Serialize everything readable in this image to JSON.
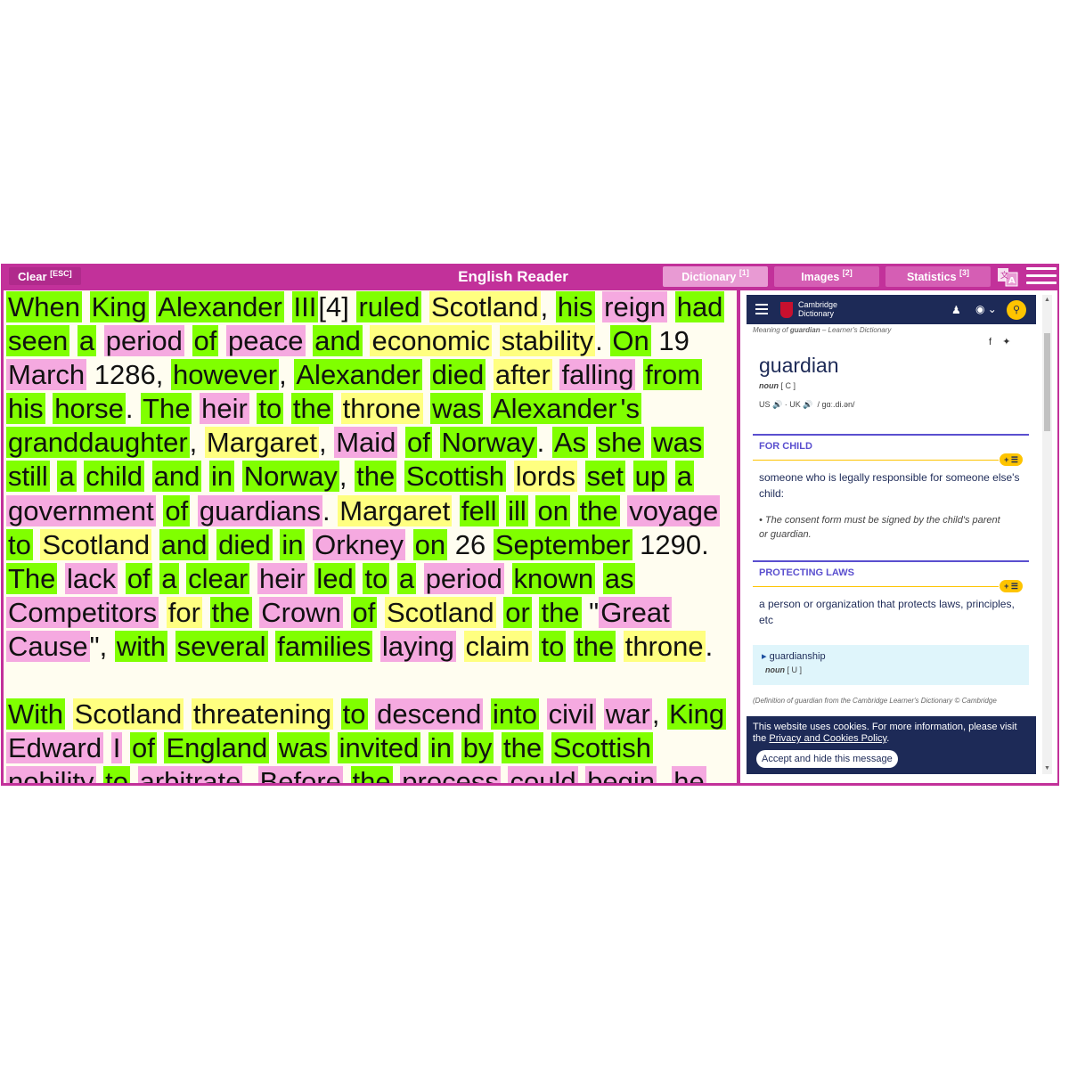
{
  "toolbar": {
    "clear_label": "Clear",
    "clear_shortcut": "[ESC]",
    "title": "English Reader",
    "tabs": [
      {
        "label": "Dictionary",
        "shortcut": "[1]"
      },
      {
        "label": "Images",
        "shortcut": "[2]"
      },
      {
        "label": "Statistics",
        "shortcut": "[3]"
      }
    ],
    "icons": [
      "translate-icon",
      "hamburger-menu-icon"
    ]
  },
  "reader": {
    "paragraphs": [
      [
        [
          "When",
          "g"
        ],
        [
          " ",
          ""
        ],
        [
          "King",
          "g"
        ],
        [
          " ",
          ""
        ],
        [
          "Alexander",
          "g"
        ],
        [
          " ",
          ""
        ],
        [
          "III",
          "g"
        ],
        [
          "[4] ",
          ""
        ],
        [
          "ruled",
          "g"
        ],
        [
          " ",
          ""
        ],
        [
          "Scotland",
          "y"
        ],
        [
          ", ",
          ""
        ],
        [
          "his",
          "g"
        ],
        [
          " ",
          ""
        ],
        [
          "reign",
          "p"
        ],
        [
          " ",
          ""
        ],
        [
          "had",
          "g"
        ],
        [
          " ",
          ""
        ],
        [
          "seen",
          "g"
        ],
        [
          " ",
          ""
        ],
        [
          "a",
          "g"
        ],
        [
          " ",
          ""
        ],
        [
          "period",
          "p"
        ],
        [
          " ",
          ""
        ],
        [
          "of",
          "g"
        ],
        [
          " ",
          ""
        ],
        [
          "peace",
          "p"
        ],
        [
          " ",
          ""
        ],
        [
          "and",
          "g"
        ],
        [
          " ",
          ""
        ],
        [
          "economic",
          "y"
        ],
        [
          " ",
          ""
        ],
        [
          "stability",
          "y"
        ],
        [
          ". ",
          ""
        ],
        [
          "On",
          "g"
        ],
        [
          " 19 ",
          ""
        ],
        [
          "March",
          "p"
        ],
        [
          " 1286, ",
          ""
        ],
        [
          "however",
          "g"
        ],
        [
          ", ",
          ""
        ],
        [
          "Alexander",
          "g"
        ],
        [
          " ",
          ""
        ],
        [
          "died",
          "g"
        ],
        [
          " ",
          ""
        ],
        [
          "after",
          "y"
        ],
        [
          " ",
          ""
        ],
        [
          "falling",
          "p"
        ],
        [
          " ",
          ""
        ],
        [
          "from",
          "g"
        ],
        [
          " ",
          ""
        ],
        [
          "his",
          "g"
        ],
        [
          " ",
          ""
        ],
        [
          "horse",
          "g"
        ],
        [
          ". ",
          ""
        ],
        [
          "The",
          "g"
        ],
        [
          " ",
          ""
        ],
        [
          "heir",
          "p"
        ],
        [
          " ",
          ""
        ],
        [
          "to",
          "g"
        ],
        [
          " ",
          ""
        ],
        [
          "the",
          "g"
        ],
        [
          " ",
          ""
        ],
        [
          "throne",
          "y"
        ],
        [
          " ",
          ""
        ],
        [
          "was",
          "g"
        ],
        [
          " ",
          ""
        ],
        [
          "Alexander",
          "g"
        ],
        [
          "'s",
          "g"
        ],
        [
          " ",
          ""
        ],
        [
          "granddaughter",
          "g"
        ],
        [
          ", ",
          ""
        ],
        [
          "Margaret",
          "y"
        ],
        [
          ", ",
          ""
        ],
        [
          "Maid",
          "p"
        ],
        [
          " ",
          ""
        ],
        [
          "of",
          "g"
        ],
        [
          " ",
          ""
        ],
        [
          "Norway",
          "g"
        ],
        [
          ". ",
          ""
        ],
        [
          "As",
          "g"
        ],
        [
          " ",
          ""
        ],
        [
          "she",
          "g"
        ],
        [
          " ",
          ""
        ],
        [
          "was",
          "g"
        ],
        [
          " ",
          ""
        ],
        [
          "still",
          "g"
        ],
        [
          " ",
          ""
        ],
        [
          "a",
          "g"
        ],
        [
          " ",
          ""
        ],
        [
          "child",
          "g"
        ],
        [
          " ",
          ""
        ],
        [
          "and",
          "g"
        ],
        [
          " ",
          ""
        ],
        [
          "in",
          "g"
        ],
        [
          " ",
          ""
        ],
        [
          "Norway",
          "g"
        ],
        [
          ", ",
          ""
        ],
        [
          "the",
          "g"
        ],
        [
          " ",
          ""
        ],
        [
          "Scottish",
          "g"
        ],
        [
          " ",
          ""
        ],
        [
          "lords",
          "y"
        ],
        [
          " ",
          ""
        ],
        [
          "set",
          "g"
        ],
        [
          " ",
          ""
        ],
        [
          "up",
          "g"
        ],
        [
          " ",
          ""
        ],
        [
          "a",
          "g"
        ],
        [
          " ",
          ""
        ],
        [
          "government",
          "p"
        ],
        [
          " ",
          ""
        ],
        [
          "of",
          "g"
        ],
        [
          " ",
          ""
        ],
        [
          "guardians",
          "p"
        ],
        [
          ". ",
          ""
        ],
        [
          "Margaret",
          "y"
        ],
        [
          " ",
          ""
        ],
        [
          "fell",
          "g"
        ],
        [
          " ",
          ""
        ],
        [
          "ill",
          "g"
        ],
        [
          " ",
          ""
        ],
        [
          "on",
          "g"
        ],
        [
          " ",
          ""
        ],
        [
          "the",
          "g"
        ],
        [
          " ",
          ""
        ],
        [
          "voyage",
          "p"
        ],
        [
          " ",
          ""
        ],
        [
          "to",
          "g"
        ],
        [
          " ",
          ""
        ],
        [
          "Scotland",
          "y"
        ],
        [
          " ",
          ""
        ],
        [
          "and",
          "g"
        ],
        [
          " ",
          ""
        ],
        [
          "died",
          "g"
        ],
        [
          " ",
          ""
        ],
        [
          "in",
          "g"
        ],
        [
          " ",
          ""
        ],
        [
          "Orkney",
          "p"
        ],
        [
          " ",
          ""
        ],
        [
          "on",
          "g"
        ],
        [
          " 26 ",
          ""
        ],
        [
          "September",
          "g"
        ],
        [
          " 1290. ",
          ""
        ],
        [
          "The",
          "g"
        ],
        [
          " ",
          ""
        ],
        [
          "lack",
          "p"
        ],
        [
          " ",
          ""
        ],
        [
          "of",
          "g"
        ],
        [
          " ",
          ""
        ],
        [
          "a",
          "g"
        ],
        [
          " ",
          ""
        ],
        [
          "clear",
          "g"
        ],
        [
          " ",
          ""
        ],
        [
          "heir",
          "p"
        ],
        [
          " ",
          ""
        ],
        [
          "led",
          "g"
        ],
        [
          " ",
          ""
        ],
        [
          "to",
          "g"
        ],
        [
          " ",
          ""
        ],
        [
          "a",
          "g"
        ],
        [
          " ",
          ""
        ],
        [
          "period",
          "p"
        ],
        [
          " ",
          ""
        ],
        [
          "known",
          "g"
        ],
        [
          " ",
          ""
        ],
        [
          "as",
          "g"
        ],
        [
          " ",
          ""
        ],
        [
          "Competitors",
          "p"
        ],
        [
          " ",
          ""
        ],
        [
          "for",
          "y"
        ],
        [
          " ",
          ""
        ],
        [
          "the",
          "g"
        ],
        [
          " ",
          ""
        ],
        [
          "Crown",
          "p"
        ],
        [
          " ",
          ""
        ],
        [
          "of",
          "g"
        ],
        [
          " ",
          ""
        ],
        [
          "Scotland",
          "y"
        ],
        [
          " ",
          ""
        ],
        [
          "or",
          "g"
        ],
        [
          " ",
          ""
        ],
        [
          "the",
          "g"
        ],
        [
          " \"",
          ""
        ],
        [
          "Great",
          "p"
        ],
        [
          " ",
          ""
        ],
        [
          "Cause",
          "p"
        ],
        [
          "\", ",
          ""
        ],
        [
          "with",
          "g"
        ],
        [
          " ",
          ""
        ],
        [
          "several",
          "g"
        ],
        [
          " ",
          ""
        ],
        [
          "families",
          "g"
        ],
        [
          " ",
          ""
        ],
        [
          "laying",
          "p"
        ],
        [
          " ",
          ""
        ],
        [
          "claim",
          "y"
        ],
        [
          " ",
          ""
        ],
        [
          "to",
          "g"
        ],
        [
          " ",
          ""
        ],
        [
          "the",
          "g"
        ],
        [
          " ",
          ""
        ],
        [
          "throne",
          "y"
        ],
        [
          ".",
          ""
        ]
      ],
      [
        [
          "With",
          "g"
        ],
        [
          " ",
          ""
        ],
        [
          "Scotland",
          "y"
        ],
        [
          " ",
          ""
        ],
        [
          "threatening",
          "y"
        ],
        [
          " ",
          ""
        ],
        [
          "to",
          "g"
        ],
        [
          " ",
          ""
        ],
        [
          "descend",
          "p"
        ],
        [
          " ",
          ""
        ],
        [
          "into",
          "g"
        ],
        [
          " ",
          ""
        ],
        [
          "civil",
          "p"
        ],
        [
          " ",
          ""
        ],
        [
          "war",
          "p"
        ],
        [
          ", ",
          ""
        ],
        [
          "King",
          "g"
        ],
        [
          " ",
          ""
        ],
        [
          "Edward",
          "p"
        ],
        [
          " ",
          ""
        ],
        [
          "I",
          "p"
        ],
        [
          " ",
          ""
        ],
        [
          "of",
          "g"
        ],
        [
          " ",
          ""
        ],
        [
          "England",
          "g"
        ],
        [
          " ",
          ""
        ],
        [
          "was",
          "g"
        ],
        [
          " ",
          ""
        ],
        [
          "invited",
          "g"
        ],
        [
          " ",
          ""
        ],
        [
          "in",
          "g"
        ],
        [
          " ",
          ""
        ],
        [
          "by",
          "g"
        ],
        [
          " ",
          ""
        ],
        [
          "the",
          "g"
        ],
        [
          " ",
          ""
        ],
        [
          "Scottish",
          "g"
        ],
        [
          " ",
          ""
        ],
        [
          "nobility",
          "p"
        ],
        [
          " ",
          ""
        ],
        [
          "to",
          "g"
        ],
        [
          " ",
          ""
        ],
        [
          "arbitrate",
          "p"
        ],
        [
          ". ",
          ""
        ],
        [
          "Before",
          "p"
        ],
        [
          " ",
          ""
        ],
        [
          "the",
          "g"
        ],
        [
          " ",
          ""
        ],
        [
          "process",
          "p"
        ],
        [
          " ",
          ""
        ],
        [
          "could",
          "p"
        ],
        [
          " ",
          ""
        ],
        [
          "begin",
          "p"
        ],
        [
          ", ",
          ""
        ],
        [
          "he",
          "p"
        ]
      ]
    ]
  },
  "dictionary": {
    "brand": "Cambridge Dictionary",
    "brand_line1": "Cambridge",
    "brand_line2": "Dictionary",
    "meaning_of_prefix": "Meaning of ",
    "meaning_of_word": "guardian",
    "meaning_of_suffix": " – Learner's Dictionary",
    "headword": "guardian",
    "pos": "noun",
    "grammar": "[ C ]",
    "pron_us": "US",
    "pron_uk": "UK",
    "pron_ipa": "/ ɡɑː.di.ən/",
    "senses": [
      {
        "label": "FOR CHILD",
        "definition": "someone who is legally responsible for someone else's child:",
        "example": "The consent form must be signed by the child's parent or guardian."
      },
      {
        "label": "PROTECTING LAWS",
        "definition": "a person or organization that protects laws, principles, etc"
      }
    ],
    "plus_label": "+ ☰",
    "related_word": "guardianship",
    "related_pos": "noun",
    "related_grammar": "[ U ]",
    "source_text": "(Definition of guardian from the Cambridge Learner's Dictionary © Cambridge",
    "cookie_text": "This website uses cookies. For more information, please visit the",
    "cookie_link": "Privacy and Cookies Policy",
    "cookie_button": "Accept and hide this message"
  },
  "colors": {
    "brand_magenta": "#c2319a",
    "highlight_green": "#80ff00",
    "highlight_yellow": "#ffff80",
    "highlight_pink": "#f5a9e0",
    "cambridge_navy": "#1d2a57",
    "cambridge_yellow": "#fec400"
  }
}
